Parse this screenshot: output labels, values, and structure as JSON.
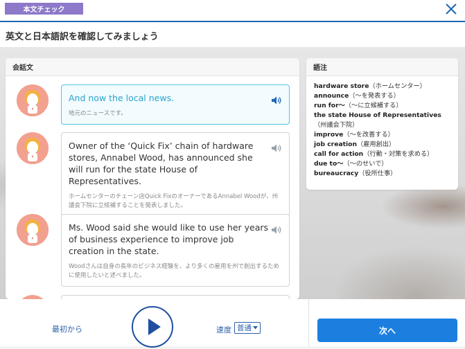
{
  "header": {
    "tag_label": "本文チェック",
    "title": "英文と日本語訳を確認してみましょう"
  },
  "conversation": {
    "title": "会話文",
    "messages": [
      {
        "en": "And now the local news.",
        "ja": "地元のニュースです。",
        "active": true
      },
      {
        "en": "Owner of the ‘Quick Fix’ chain of hardware stores, Annabel Wood, has announced she will run for the state House of Representatives.",
        "ja": "ホームセンターのチェーン店Quick FixのオーナーであるAnnabel Woodが、州議会下院に立候補することを発表しました。",
        "active": false
      },
      {
        "en": "Ms. Wood said she would like to use her years of business experience to improve job creation in the state.",
        "ja": "Woodさんは自身の長年のビジネス経験を、より多くの雇用を州で創出するために使用したいと述べました。",
        "active": false
      }
    ]
  },
  "glossary": {
    "title": "語注",
    "items": [
      {
        "term": "hardware store",
        "meaning": "（ホームセンター）"
      },
      {
        "term": "announce",
        "meaning": "（～を発表する）"
      },
      {
        "term": "run for～",
        "meaning": "（～に立候補する）"
      },
      {
        "term": "the state House of Representatives",
        "meaning": "（州議会下院）"
      },
      {
        "term": "improve",
        "meaning": "（～を改善する）"
      },
      {
        "term": "job creation",
        "meaning": "（雇用創出）"
      },
      {
        "term": "call for action",
        "meaning": "（行動・対策を求める）"
      },
      {
        "term": "due to～",
        "meaning": "（～のせいで）"
      },
      {
        "term": "bureaucracy",
        "meaning": "（役所仕事）"
      }
    ]
  },
  "controls": {
    "restart_label": "最初から",
    "speed_label": "速度",
    "speed_value": "普通",
    "next_label": "次へ"
  },
  "colors": {
    "accent": "#1f67b5",
    "tag": "#8d78c9",
    "active_text": "#2aa4cf",
    "next_button": "#1c7fe0"
  },
  "icons": [
    "close-icon",
    "speaker-icon",
    "play-icon",
    "chevron-down-icon",
    "avatar-icon"
  ]
}
